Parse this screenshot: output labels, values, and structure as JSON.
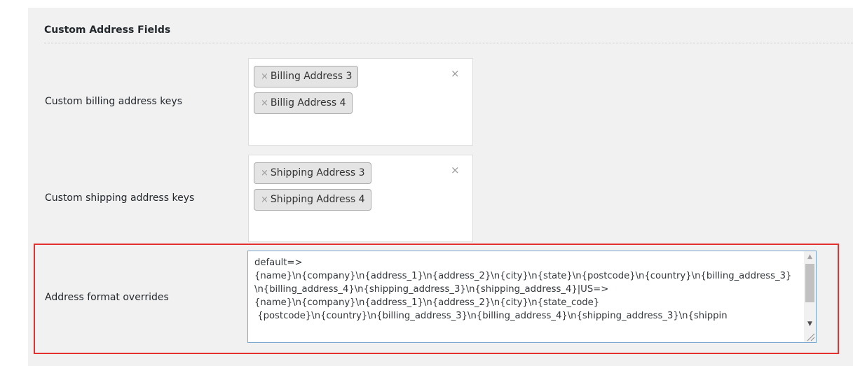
{
  "section": {
    "title": "Custom Address Fields"
  },
  "billing": {
    "label": "Custom billing address keys",
    "tags": [
      "Billing Address 3",
      "Billig Address 4"
    ],
    "remove_glyph": "×",
    "clear_glyph": "×"
  },
  "shipping": {
    "label": "Custom shipping address keys",
    "tags": [
      "Shipping Address 3",
      "Shipping Address 4"
    ],
    "remove_glyph": "×",
    "clear_glyph": "×"
  },
  "address_format": {
    "label": "Address format overrides",
    "value": "default=>\n{name}\\n{company}\\n{address_1}\\n{address_2}\\n{city}\\n{state}\\n{postcode}\\n{country}\\n{billing_address_3}\\n{billing_address_4}\\n{shipping_address_3}\\n{shipping_address_4}|US=>\n{name}\\n{company}\\n{address_1}\\n{address_2}\\n{city}\\n{state_code}\n {postcode}\\n{country}\\n{billing_address_3}\\n{billing_address_4}\\n{shipping_address_3}\\n{shippin"
  },
  "colors": {
    "highlight_border": "#e53030",
    "panel_background": "#f1f1f1",
    "tag_background": "#e4e4e4"
  },
  "icons": {
    "scroll_up": "arrow-up-icon",
    "scroll_down": "arrow-down-icon",
    "resize": "resize-grip-icon"
  }
}
